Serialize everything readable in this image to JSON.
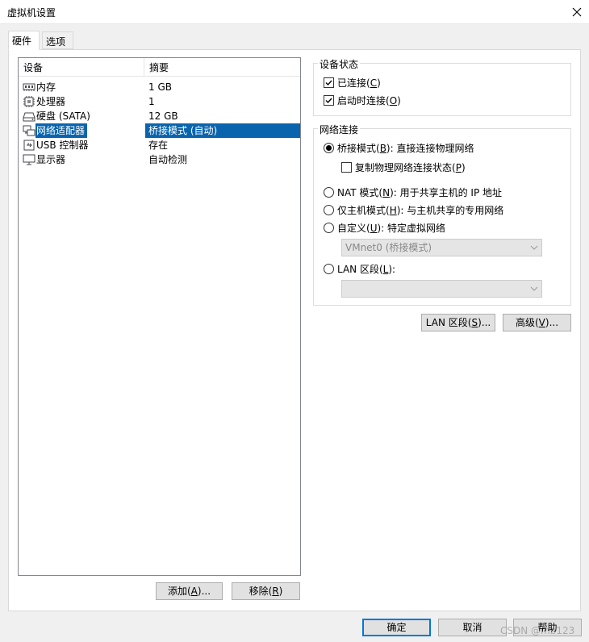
{
  "window": {
    "title": "虚拟机设置",
    "close_glyph": "✕"
  },
  "tabs": [
    {
      "label": "硬件",
      "active": true
    },
    {
      "label": "选项",
      "active": false
    }
  ],
  "device_list": {
    "columns": [
      "设备",
      "摘要"
    ],
    "rows": [
      {
        "icon": "memory-icon",
        "name": "内存",
        "summary": "1 GB"
      },
      {
        "icon": "processor-icon",
        "name": "处理器",
        "summary": "1"
      },
      {
        "icon": "hard-disk-icon",
        "name": "硬盘 (SATA)",
        "summary": "12 GB"
      },
      {
        "icon": "network-adapter-icon",
        "name": "网络适配器",
        "summary": "桥接模式 (自动)",
        "selected": true
      },
      {
        "icon": "usb-controller-icon",
        "name": "USB 控制器",
        "summary": "存在"
      },
      {
        "icon": "display-icon",
        "name": "显示器",
        "summary": "自动检测"
      }
    ]
  },
  "list_buttons": {
    "add": {
      "pre": "添加(",
      "key": "A",
      "post": ")..."
    },
    "remove": {
      "pre": "移除(",
      "key": "R",
      "post": ")"
    }
  },
  "device_status": {
    "title": "设备状态",
    "connected": {
      "pre": "已连接(",
      "key": "C",
      "post": ")",
      "checked": true
    },
    "connect_at_power_on": {
      "pre": "启动时连接(",
      "key": "O",
      "post": ")",
      "checked": true
    }
  },
  "network_connection": {
    "title": "网络连接",
    "bridged": {
      "pre": "桥接模式(",
      "key": "B",
      "post": "): 直接连接物理网络",
      "selected": true
    },
    "replicate": {
      "pre": "复制物理网络连接状态(",
      "key": "P",
      "post": ")",
      "checked": false
    },
    "nat": {
      "pre": "NAT 模式(",
      "key": "N",
      "post": "): 用于共享主机的 IP 地址",
      "selected": false
    },
    "host_only": {
      "pre": "仅主机模式(",
      "key": "H",
      "post": "): 与主机共享的专用网络",
      "selected": false
    },
    "custom": {
      "pre": "自定义(",
      "key": "U",
      "post": "): 特定虚拟网络",
      "selected": false
    },
    "custom_combo_value": "VMnet0 (桥接模式)",
    "lan_segment": {
      "pre": "LAN 区段(",
      "key": "L",
      "post": "):",
      "selected": false
    },
    "lan_combo_value": ""
  },
  "side_buttons": {
    "lan_segments": {
      "pre": "LAN 区段(",
      "key": "S",
      "post": ")..."
    },
    "advanced": {
      "pre": "高级(",
      "key": "V",
      "post": ")..."
    }
  },
  "dialog_buttons": {
    "ok": "确定",
    "cancel": "取消",
    "help": "帮助"
  },
  "watermark": "CSDN @mb123",
  "colors": {
    "selection": "#0a64ad",
    "default_button_border": "#0078d7"
  }
}
